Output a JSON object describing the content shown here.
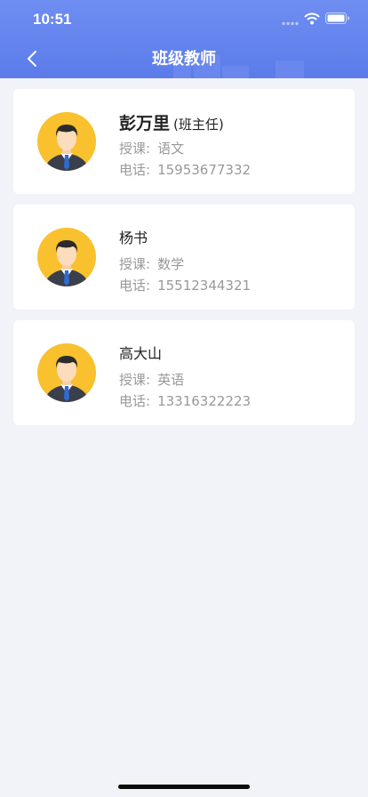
{
  "status_bar": {
    "time": "10:51"
  },
  "nav": {
    "title": "班级教师",
    "back_icon": "chevron-left-icon"
  },
  "colors": {
    "header": "#5b7be9",
    "avatar_bg": "#f9c12e",
    "page_bg": "#f2f3f8"
  },
  "teachers": [
    {
      "name": "彭万里",
      "role": "(班主任)",
      "subject_label": "授课:",
      "subject": "语文",
      "phone_label": "电话:",
      "phone": "15953677332"
    },
    {
      "name": "杨书",
      "role": "",
      "subject_label": "授课:",
      "subject": "数学",
      "phone_label": "电话:",
      "phone": "15512344321"
    },
    {
      "name": "高大山",
      "role": "",
      "subject_label": "授课:",
      "subject": "英语",
      "phone_label": "电话:",
      "phone": "13316322223"
    }
  ]
}
